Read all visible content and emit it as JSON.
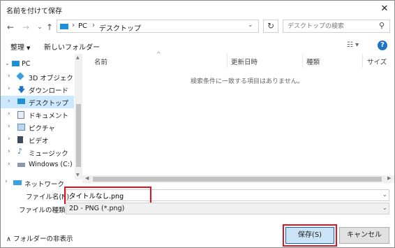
{
  "window": {
    "title": "名前を付けて保存",
    "close_glyph": "✕"
  },
  "nav_buttons": {
    "back": "←",
    "forward": "→",
    "recent": "⌄",
    "up": "↑"
  },
  "address": {
    "sep1": "›",
    "pc": "PC",
    "sep2": "›",
    "location": "デスクトップ",
    "dropdown": "⌄"
  },
  "refresh_glyph": "↻",
  "search": {
    "placeholder": "デスクトップの検索",
    "icon_glyph": "⚲"
  },
  "toolbar": {
    "organize": "整理",
    "organize_caret": "▼",
    "new_folder": "新しいフォルダー",
    "view_glyph": "☷ ▾",
    "help": "?"
  },
  "sidebar": {
    "items": [
      {
        "label": "PC",
        "icon": "pc-icon",
        "color": "#1e90d6"
      },
      {
        "label": "3D オブジェクト",
        "icon": "3d-objects-icon",
        "color": "#3aa0e0"
      },
      {
        "label": "ダウンロード",
        "icon": "download-icon",
        "color": "#1e73c8"
      },
      {
        "label": "デスクトップ",
        "icon": "desktop-icon",
        "color": "#1e90d6",
        "selected": true
      },
      {
        "label": "ドキュメント",
        "icon": "documents-icon",
        "color": "#6d7f95"
      },
      {
        "label": "ピクチャ",
        "icon": "pictures-icon",
        "color": "#5a8fbf"
      },
      {
        "label": "ビデオ",
        "icon": "videos-icon",
        "color": "#3b4a5c"
      },
      {
        "label": "ミュージック",
        "icon": "music-icon",
        "color": "#1e73c8"
      },
      {
        "label": "Windows (C:)",
        "icon": "drive-icon",
        "color": "#8a9bb0"
      }
    ],
    "network": "ネットワーク"
  },
  "file_list": {
    "columns": [
      "名前",
      "更新日時",
      "種類",
      "サイズ"
    ],
    "empty_message": "検索条件に一致する項目はありません。"
  },
  "fields": {
    "filename_label": "ファイル名(N):",
    "filename_value": "タイトルなし.png",
    "filetype_label": "ファイルの種類(T):",
    "filetype_value": "2D - PNG (*.png)"
  },
  "footer": {
    "hide_folders": "フォルダーの非表示",
    "hide_caret": "∧",
    "save": "保存(S)",
    "cancel": "キャンセル"
  },
  "colors": {
    "highlight": "#e0141e",
    "selection": "#cce8ff",
    "accent": "#1e73c8"
  }
}
